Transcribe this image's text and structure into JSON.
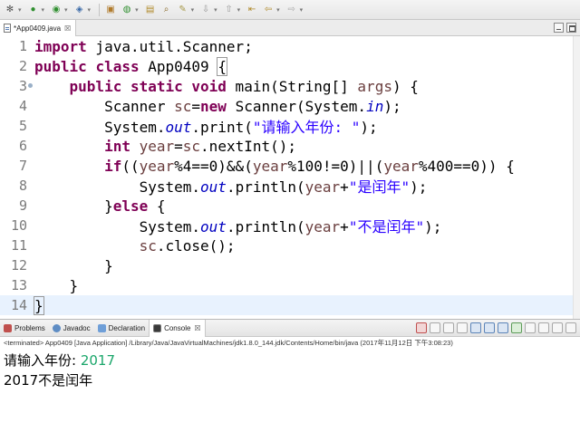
{
  "editor": {
    "tab_label": "*App0409.java",
    "lines": [
      {
        "no": "1"
      },
      {
        "no": "2"
      },
      {
        "no": "3"
      },
      {
        "no": "4"
      },
      {
        "no": "5"
      },
      {
        "no": "6"
      },
      {
        "no": "7"
      },
      {
        "no": "8"
      },
      {
        "no": "9"
      },
      {
        "no": "10"
      },
      {
        "no": "11"
      },
      {
        "no": "12"
      },
      {
        "no": "13"
      },
      {
        "no": "14"
      }
    ],
    "tokens": {
      "import_kw": "import",
      "import_path": " java.util.Scanner;",
      "public_kw": "public",
      "class_kw": "class",
      "class_name": " App0409 ",
      "open_brace": "{",
      "public_static_void": "public static void",
      "main_sig": " main(String[] ",
      "args": "args",
      "main_end": ") {",
      "scanner_decl": "Scanner ",
      "sc": "sc",
      "assign": "=",
      "new_kw": "new",
      "scanner_ctor": " Scanner(System.",
      "in_fld": "in",
      "ctor_end": ");",
      "system": "System.",
      "out_fld": "out",
      "print_call": ".print(",
      "prompt_str": "\"请输入年份: \"",
      "call_end": ");",
      "int_kw": "int",
      "year": "year",
      "next_int": ".nextInt();",
      "if_kw": "if",
      "cond_a": "((",
      "cond_b": "%4==0)&&(",
      "cond_c": "%100!=0)||(",
      "cond_d": "%400==0)) {",
      "println_call": ".println(",
      "plus": "+",
      "leap_str": "\"是闰年\"",
      "else_open": "}",
      "else_kw": "else",
      "else_brace": " {",
      "not_leap_str": "\"不是闰年\"",
      "sc_close": ".close();",
      "close_brace": "}"
    }
  },
  "console": {
    "tabs": [
      "Problems",
      "Javadoc",
      "Declaration",
      "Console"
    ],
    "tab_close": "☒",
    "terminated": "<terminated> App0409 [Java Application] /Library/Java/JavaVirtualMachines/jdk1.8.0_144.jdk/Contents/Home/bin/java (2017年11月12日 下午3:08:23)",
    "prompt": "请输入年份: ",
    "input": "2017",
    "result": "2017不是闰年"
  },
  "colors": {
    "keyword": "#7f0055",
    "string": "#2a00ff",
    "field": "#0000c0",
    "local_var": "#6a3e3e",
    "console_input": "#1aa66a"
  }
}
